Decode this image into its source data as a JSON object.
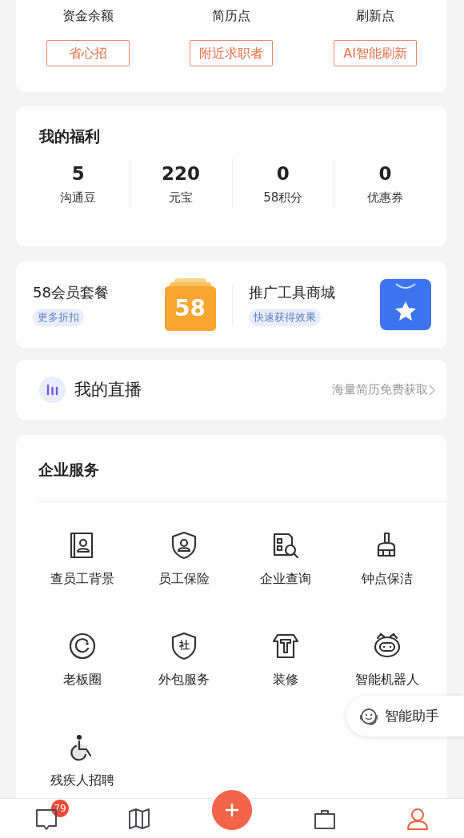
{
  "top_stats": [
    {
      "label": "资金余额",
      "button": "省心招"
    },
    {
      "label": "简历点",
      "button": "附近求职者"
    },
    {
      "label": "刷新点",
      "button": "AI智能刷新"
    }
  ],
  "welfare": {
    "title": "我的福利",
    "items": [
      {
        "value": "5",
        "label": "沟通豆"
      },
      {
        "value": "220",
        "label": "元宝"
      },
      {
        "value": "0",
        "label": "58积分"
      },
      {
        "value": "0",
        "label": "优惠券"
      }
    ]
  },
  "promos": [
    {
      "kind": "membership",
      "title": "58会员套餐",
      "tag": "更多折扣",
      "icon_text": "58"
    },
    {
      "kind": "store",
      "title": "推广工具商城",
      "tag": "快速获得效果"
    }
  ],
  "live": {
    "title": "我的直播",
    "hint": "海量简历免费获取"
  },
  "services": {
    "title": "企业服务",
    "items": [
      {
        "kind": "book",
        "label": "查员工背景"
      },
      {
        "kind": "shield",
        "label": "员工保险"
      },
      {
        "kind": "search",
        "label": "企业查询"
      },
      {
        "kind": "broom",
        "label": "钟点保洁"
      },
      {
        "kind": "circle",
        "label": "老板圈"
      },
      {
        "kind": "badge",
        "label": "外包服务",
        "icon_text": "社"
      },
      {
        "kind": "house",
        "label": "装修"
      },
      {
        "kind": "robot",
        "label": "智能机器人"
      },
      {
        "kind": "wheelchair",
        "label": "残疾人招聘"
      }
    ]
  },
  "assistant": {
    "label": "智能助手"
  },
  "tabbar": {
    "tabs": [
      {
        "kind": "message",
        "badge": "79",
        "selected": false
      },
      {
        "kind": "map",
        "selected": false
      },
      {
        "kind": "post",
        "selected": false
      },
      {
        "kind": "manage",
        "selected": false
      },
      {
        "kind": "profile",
        "selected": true
      }
    ]
  }
}
